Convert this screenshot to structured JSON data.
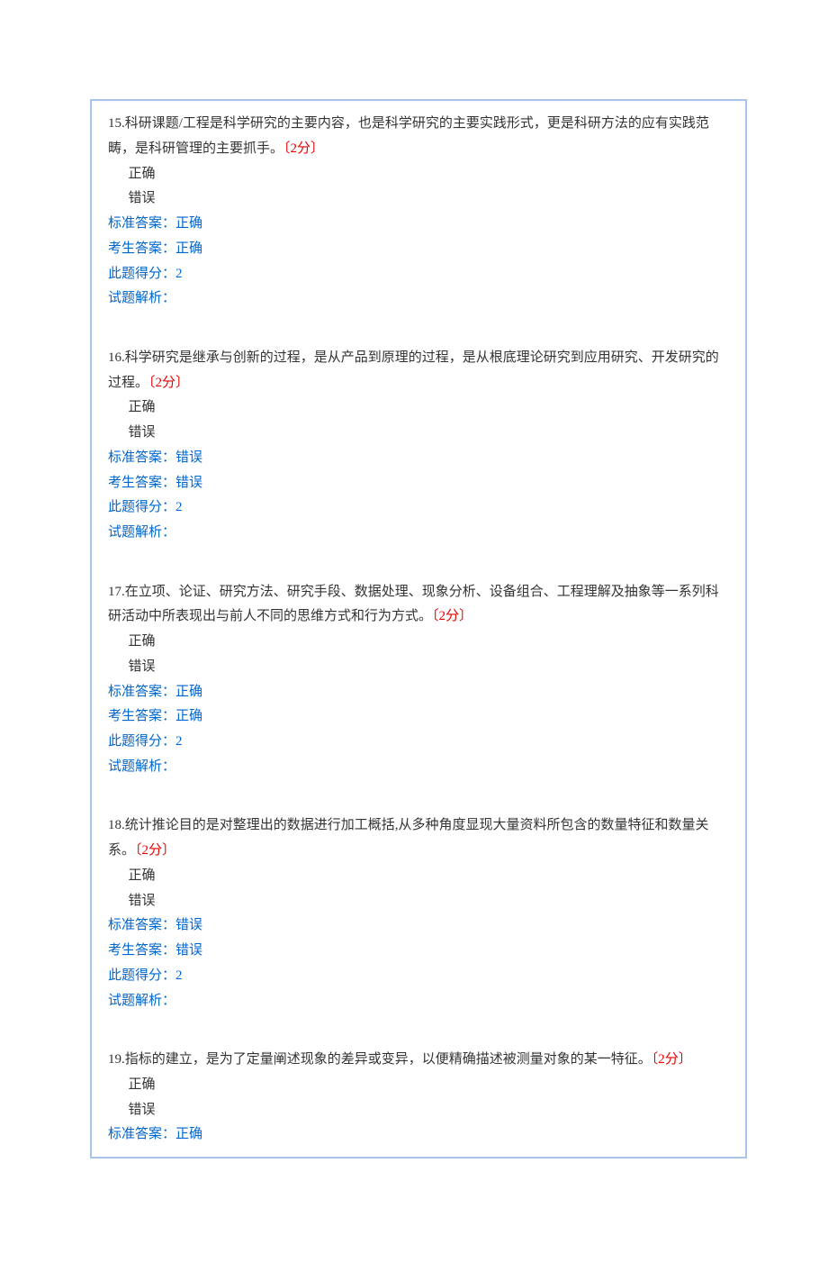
{
  "questions": [
    {
      "number_text": "15.科研课题/工程是科学研究的主要内容，也是科学研究的主要实践形式，更是科研方法的应有实践范畴，是科研管理的主要抓手。",
      "points": "〔2分〕",
      "option_correct": "正确",
      "option_wrong": "错误",
      "standard_label": "标准答案：",
      "standard_value": "正确",
      "candidate_label": "考生答案：",
      "candidate_value": "正确",
      "score_label": "此题得分：",
      "score_value": "2",
      "analysis_label": "试题解析：",
      "analysis_value": ""
    },
    {
      "number_text": "16.科学研究是继承与创新的过程，是从产品到原理的过程，是从根底理论研究到应用研究、开发研究的过程。",
      "points": "〔2分〕",
      "option_correct": "正确",
      "option_wrong": "错误",
      "standard_label": "标准答案：",
      "standard_value": "错误",
      "candidate_label": "考生答案：",
      "candidate_value": "错误",
      "score_label": "此题得分：",
      "score_value": "2",
      "analysis_label": "试题解析：",
      "analysis_value": ""
    },
    {
      "number_text": "17.在立项、论证、研究方法、研究手段、数据处理、现象分析、设备组合、工程理解及抽象等一系列科研活动中所表现出与前人不同的思维方式和行为方式。",
      "points": "〔2分〕",
      "option_correct": "正确",
      "option_wrong": "错误",
      "standard_label": "标准答案：",
      "standard_value": "正确",
      "candidate_label": "考生答案：",
      "candidate_value": "正确",
      "score_label": "此题得分：",
      "score_value": "2",
      "analysis_label": "试题解析：",
      "analysis_value": ""
    },
    {
      "number_text": "18.统计推论目的是对整理出的数据进行加工概括,从多种角度显现大量资料所包含的数量特征和数量关系。",
      "points": "〔2分〕",
      "option_correct": "正确",
      "option_wrong": "错误",
      "standard_label": "标准答案：",
      "standard_value": "错误",
      "candidate_label": "考生答案：",
      "candidate_value": "错误",
      "score_label": "此题得分：",
      "score_value": "2",
      "analysis_label": "试题解析：",
      "analysis_value": ""
    },
    {
      "number_text": "19.指标的建立，是为了定量阐述现象的差异或变异，以便精确描述被测量对象的某一特征。",
      "points": "〔2分〕",
      "option_correct": "正确",
      "option_wrong": "错误",
      "standard_label": "标准答案：",
      "standard_value": "正确"
    }
  ]
}
